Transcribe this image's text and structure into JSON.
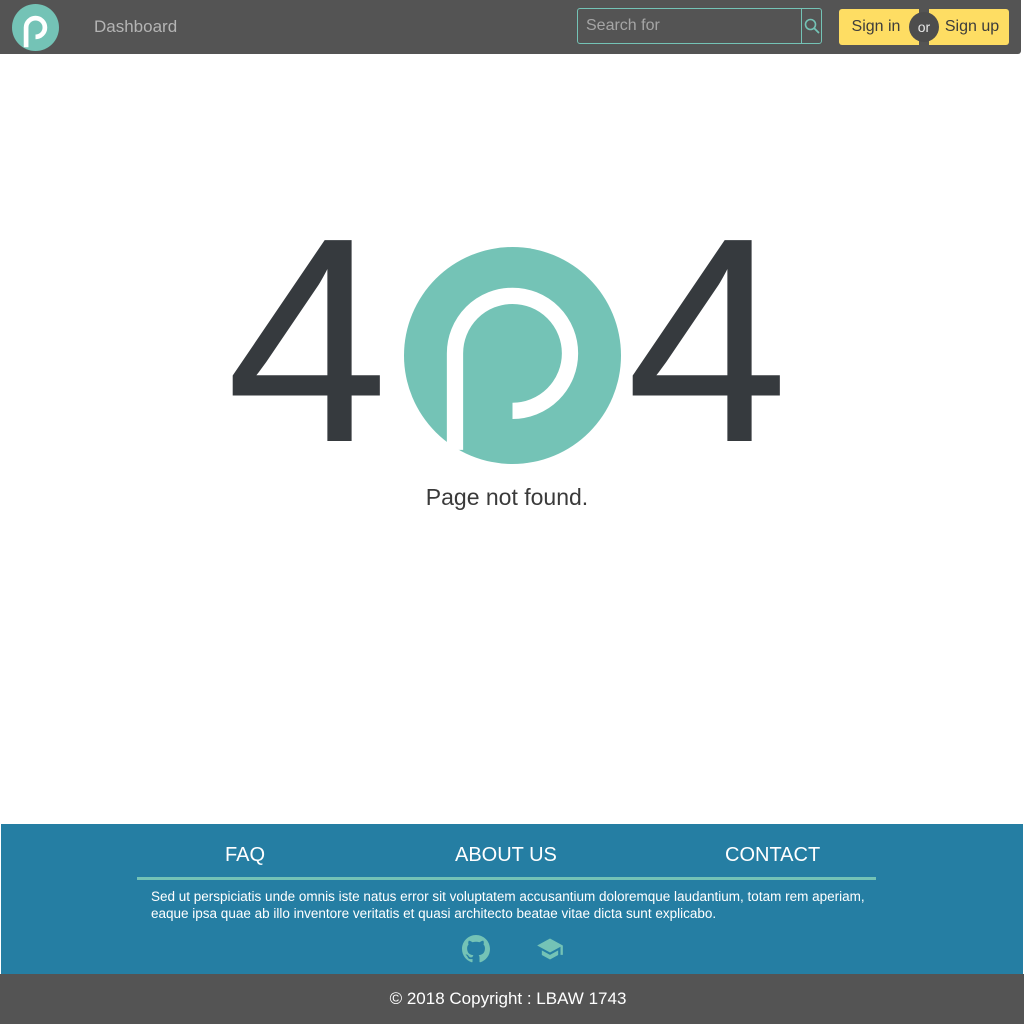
{
  "navbar": {
    "logo_name": "p-logo",
    "nav_link": "Dashboard",
    "search": {
      "placeholder": "Search for",
      "value": ""
    },
    "sign_in": "Sign in",
    "or": "or",
    "sign_up": "Sign up"
  },
  "error": {
    "digit_left": "4",
    "digit_right": "4",
    "message": "Page not found."
  },
  "footer": {
    "links": [
      "FAQ",
      "ABOUT US",
      "CONTACT"
    ],
    "text": "Sed ut perspiciatis unde omnis iste natus error sit voluptatem accusantium doloremque laudantium, totam rem aperiam, eaque ipsa quae ab illo inventore veritatis et quasi architecto beatae vitae dicta sunt explicabo.",
    "icons": [
      "github-icon",
      "graduation-cap-icon"
    ],
    "copyright": "© 2018 Copyright : LBAW 1743"
  },
  "colors": {
    "navbar_bg": "#545454",
    "accent_teal": "#74c3b6",
    "button_yellow": "#fedd63",
    "footer_blue": "#257ea3",
    "digit_dark": "#363a3e"
  }
}
